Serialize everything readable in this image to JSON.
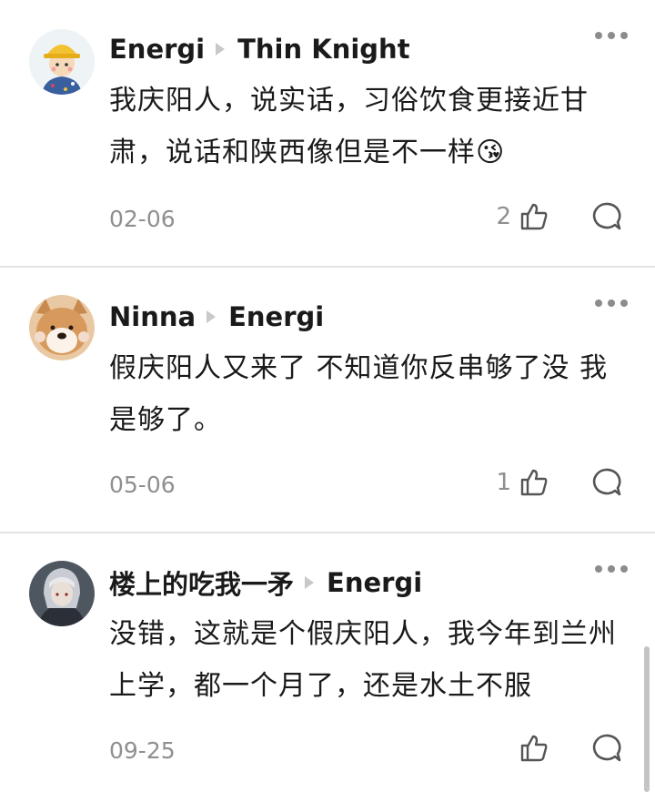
{
  "comments": [
    {
      "author": "Energi",
      "reply_to": "Thin Knight",
      "text": "我庆阳人，说实话，习俗饮食更接近甘肃，说话和陕西像但是不一样😘",
      "date": "02-06",
      "likes": "2",
      "avatar": "cartoon-boy-yellow-hat"
    },
    {
      "author": "Ninna",
      "reply_to": "Energi",
      "text": "假庆阳人又来了 不知道你反串够了没 我是够了。",
      "date": "05-06",
      "likes": "1",
      "avatar": "shiba-dog"
    },
    {
      "author": "楼上的吃我一矛",
      "reply_to": "Energi",
      "text": "没错，这就是个假庆阳人，我今年到兰州上学，都一个月了，还是水土不服",
      "date": "09-25",
      "likes": "",
      "avatar": "armored-anime-character"
    }
  ],
  "icons": {
    "more": "more-dots-icon",
    "like": "thumbs-up-icon",
    "reply": "comment-bubble-icon",
    "separator": "reply-arrow-icon"
  },
  "colors": {
    "text": "#1a1a1a",
    "meta": "#8f8f8f",
    "divider": "#e3e3e3"
  }
}
